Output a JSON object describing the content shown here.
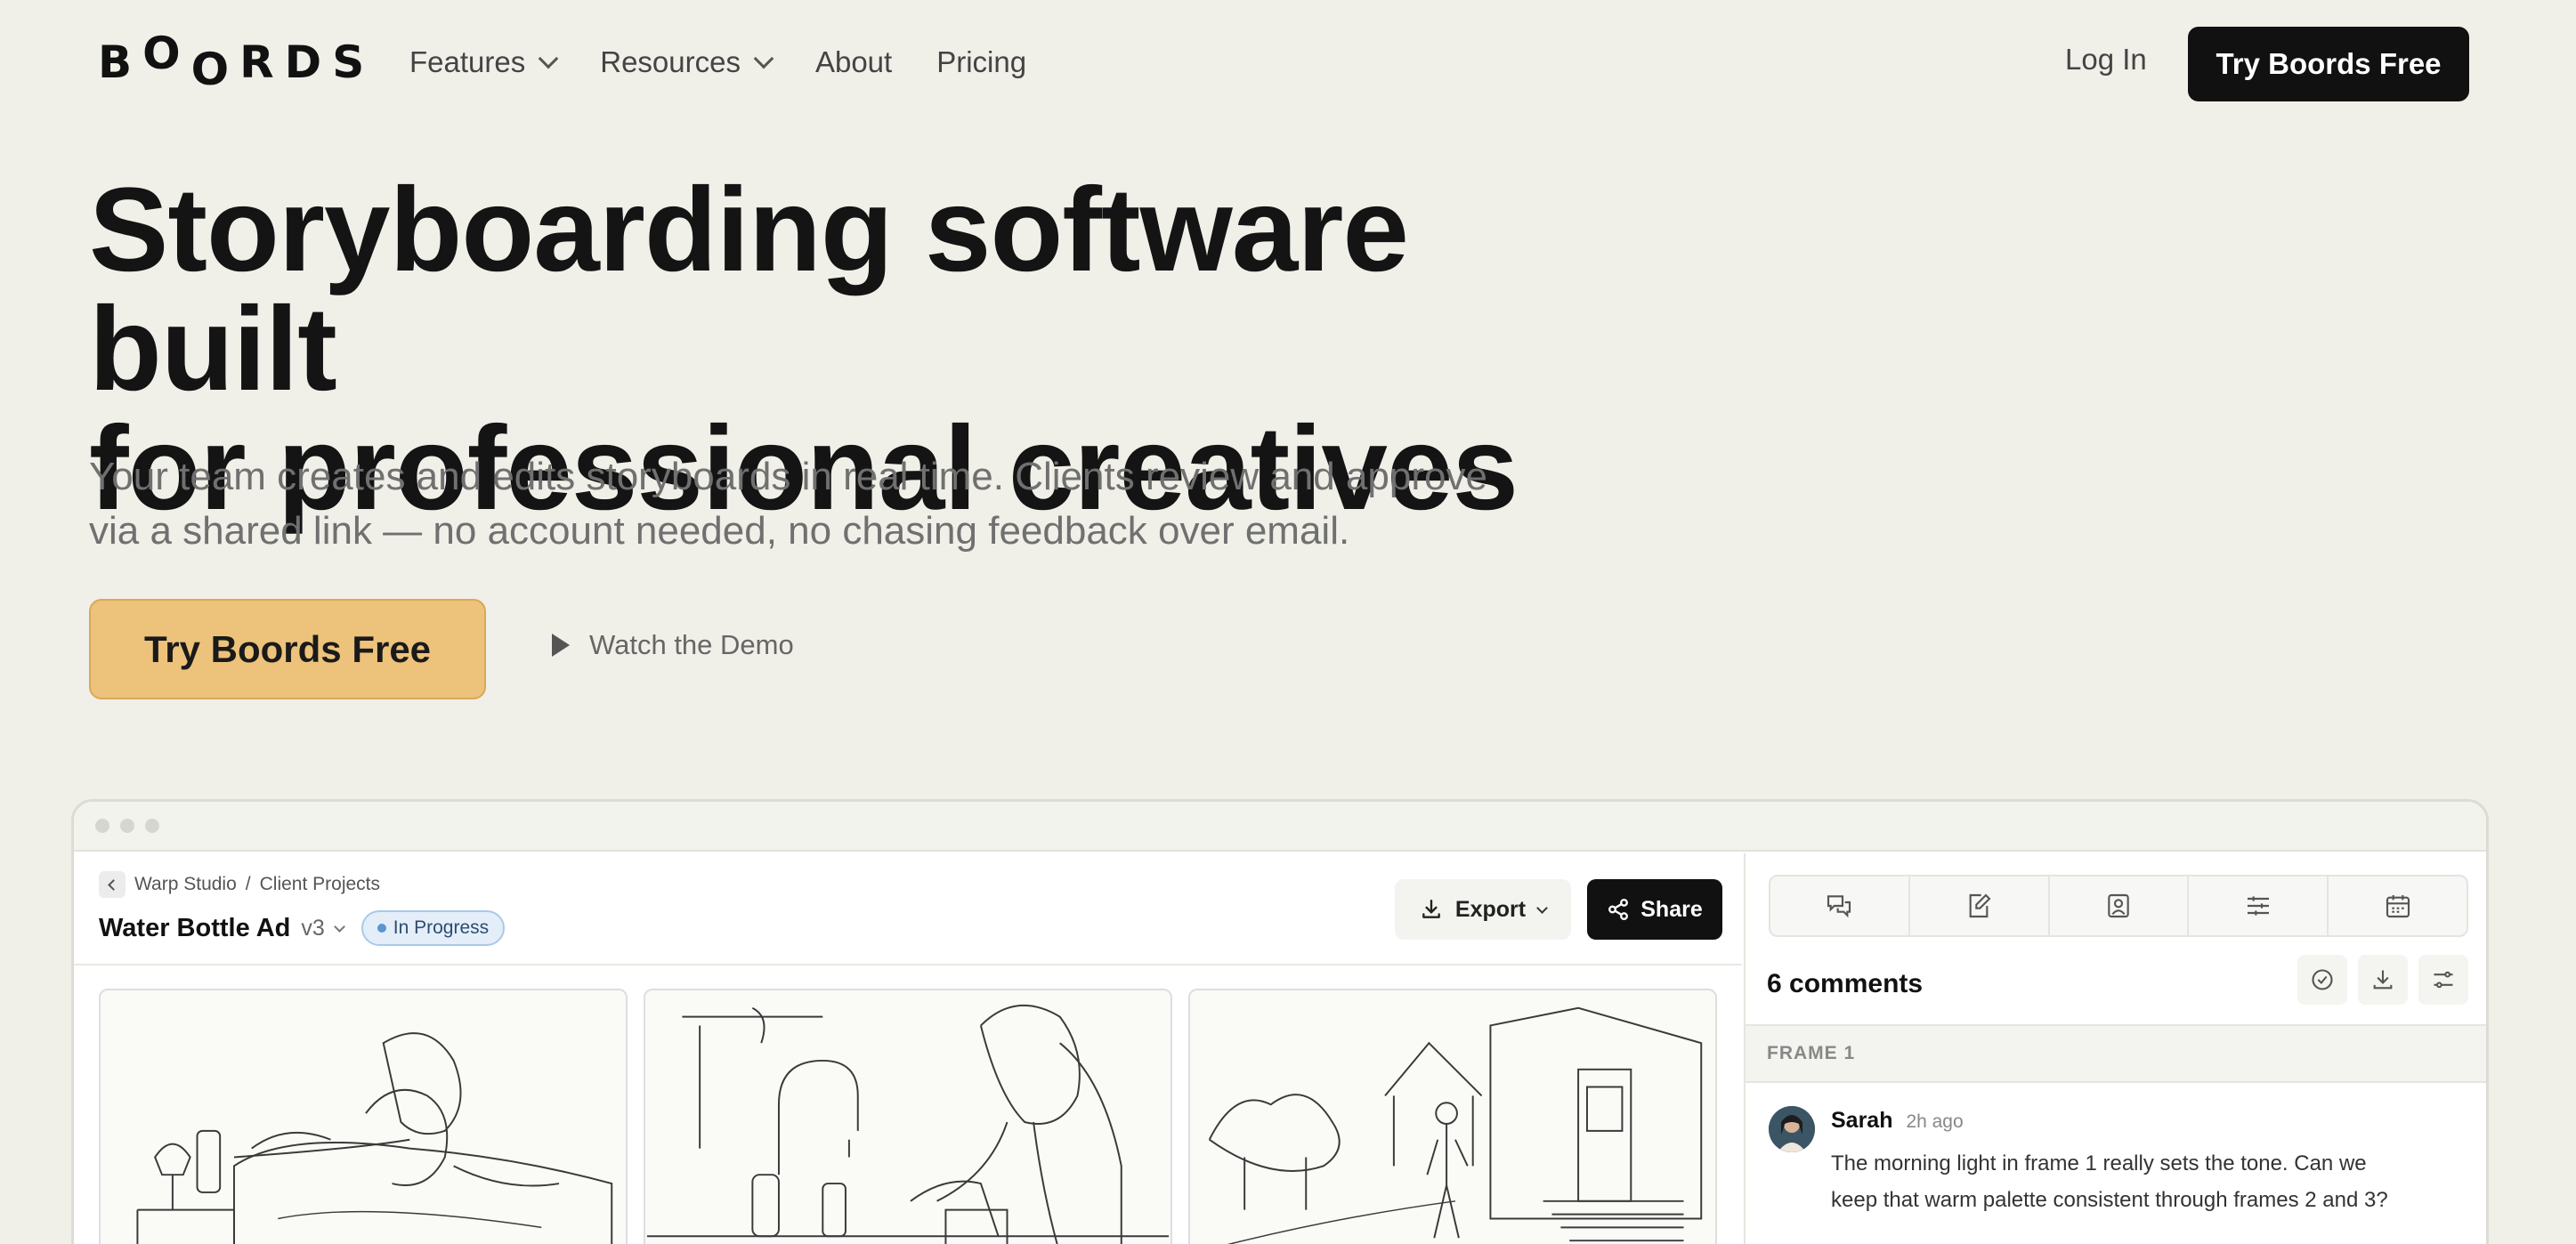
{
  "nav": {
    "logo_letters": [
      "B",
      "O",
      "O",
      "R",
      "D",
      "S"
    ],
    "links": [
      {
        "label": "Features",
        "dropdown": true
      },
      {
        "label": "Resources",
        "dropdown": true
      },
      {
        "label": "About",
        "dropdown": false
      },
      {
        "label": "Pricing",
        "dropdown": false
      }
    ],
    "login_label": "Log In",
    "cta_label": "Try Boords Free"
  },
  "hero": {
    "title_line1": "Storyboarding software built",
    "title_line2": "for professional creatives",
    "subtitle_line1": "Your team creates and edits storyboards in real time. Clients review and approve",
    "subtitle_line2": "via a shared link — no account needed, no chasing feedback over email.",
    "cta_label": "Try Boords Free",
    "demo_label": "Watch the Demo"
  },
  "app": {
    "breadcrumb": {
      "workspace": "Warp Studio",
      "separator": "/",
      "folder": "Client Projects"
    },
    "project_name": "Water Bottle Ad",
    "version": "v3",
    "status": "In Progress",
    "export_label": "Export",
    "share_label": "Share",
    "frames": [
      {
        "icon": "sketch-bedroom"
      },
      {
        "icon": "sketch-kitchen"
      },
      {
        "icon": "sketch-house-exterior"
      }
    ],
    "side_tabs": [
      "comments-icon",
      "edit-icon",
      "image-icon",
      "settings-sliders-icon",
      "calendar-icon"
    ],
    "comments_count_label": "6 comments",
    "frame_label": "FRAME 1",
    "comment": {
      "author": "Sarah",
      "time": "2h ago",
      "text_line1": "The morning light in frame 1 really sets the tone. Can we",
      "text_line2": "keep that warm palette consistent through frames 2 and 3?"
    }
  },
  "colors": {
    "background": "#f0efe8",
    "primary_dark": "#111111",
    "hero_cta": "#edc27a",
    "status_blue": "#5b95d2"
  }
}
